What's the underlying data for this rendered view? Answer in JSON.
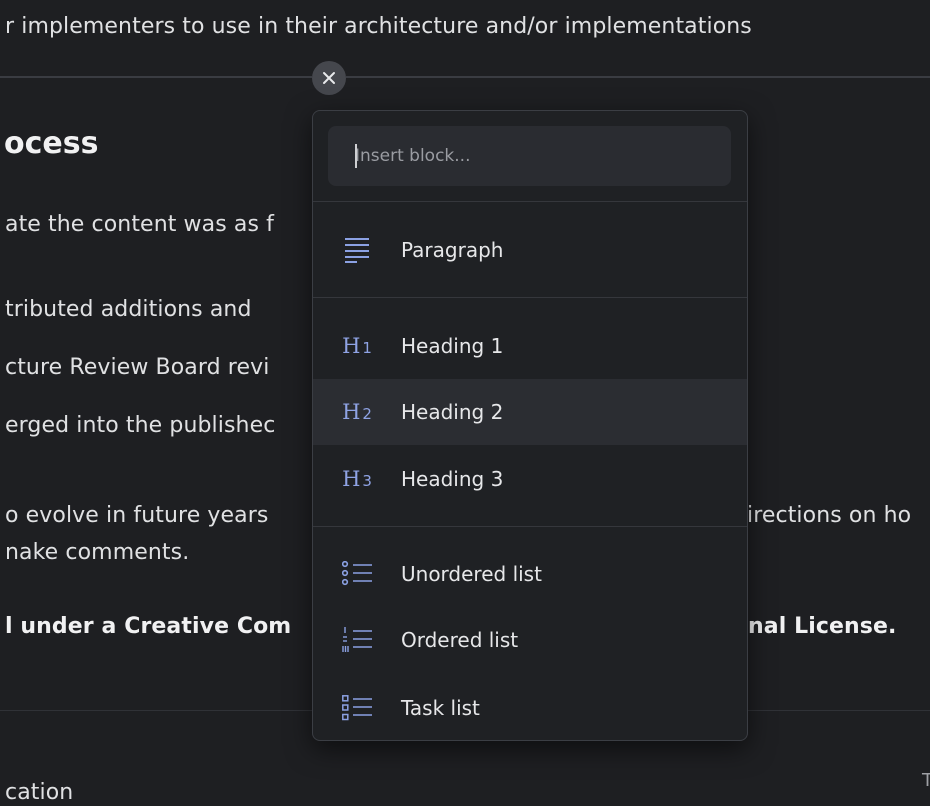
{
  "document": {
    "top_line": "r implementers to use in their architecture and/or implementations",
    "section_heading": "ocess",
    "paragraph1": "ate the content was as f",
    "list1": "tributed additions and",
    "list2": "cture Review Board revi",
    "list3": "erged into the publishec",
    "evolve_left": "o evolve in future years",
    "evolve_right": "irections on ho",
    "comments": "nake comments.",
    "license_left": "l under a Creative Com",
    "license_right": "nal License.",
    "bottom_label": "cation",
    "edge_glyph": "T"
  },
  "close_button": {
    "icon": "close-icon",
    "glyph": "✕"
  },
  "block_menu": {
    "search_placeholder": "Insert block...",
    "items": [
      {
        "label": "Paragraph",
        "icon": "paragraph-icon"
      },
      {
        "label": "Heading 1",
        "icon": "heading-1-icon",
        "icon_text": "H",
        "icon_sub": "1"
      },
      {
        "label": "Heading 2",
        "icon": "heading-2-icon",
        "icon_text": "H",
        "icon_sub": "2",
        "active": true
      },
      {
        "label": "Heading 3",
        "icon": "heading-3-icon",
        "icon_text": "H",
        "icon_sub": "3"
      },
      {
        "label": "Unordered list",
        "icon": "unordered-list-icon"
      },
      {
        "label": "Ordered list",
        "icon": "ordered-list-icon"
      },
      {
        "label": "Task list",
        "icon": "task-list-icon"
      }
    ]
  },
  "colors": {
    "background": "#1e1f22",
    "popup_background": "#1f2124",
    "icon_accent": "#8ba1e3",
    "active_item": "#2b2d32"
  }
}
